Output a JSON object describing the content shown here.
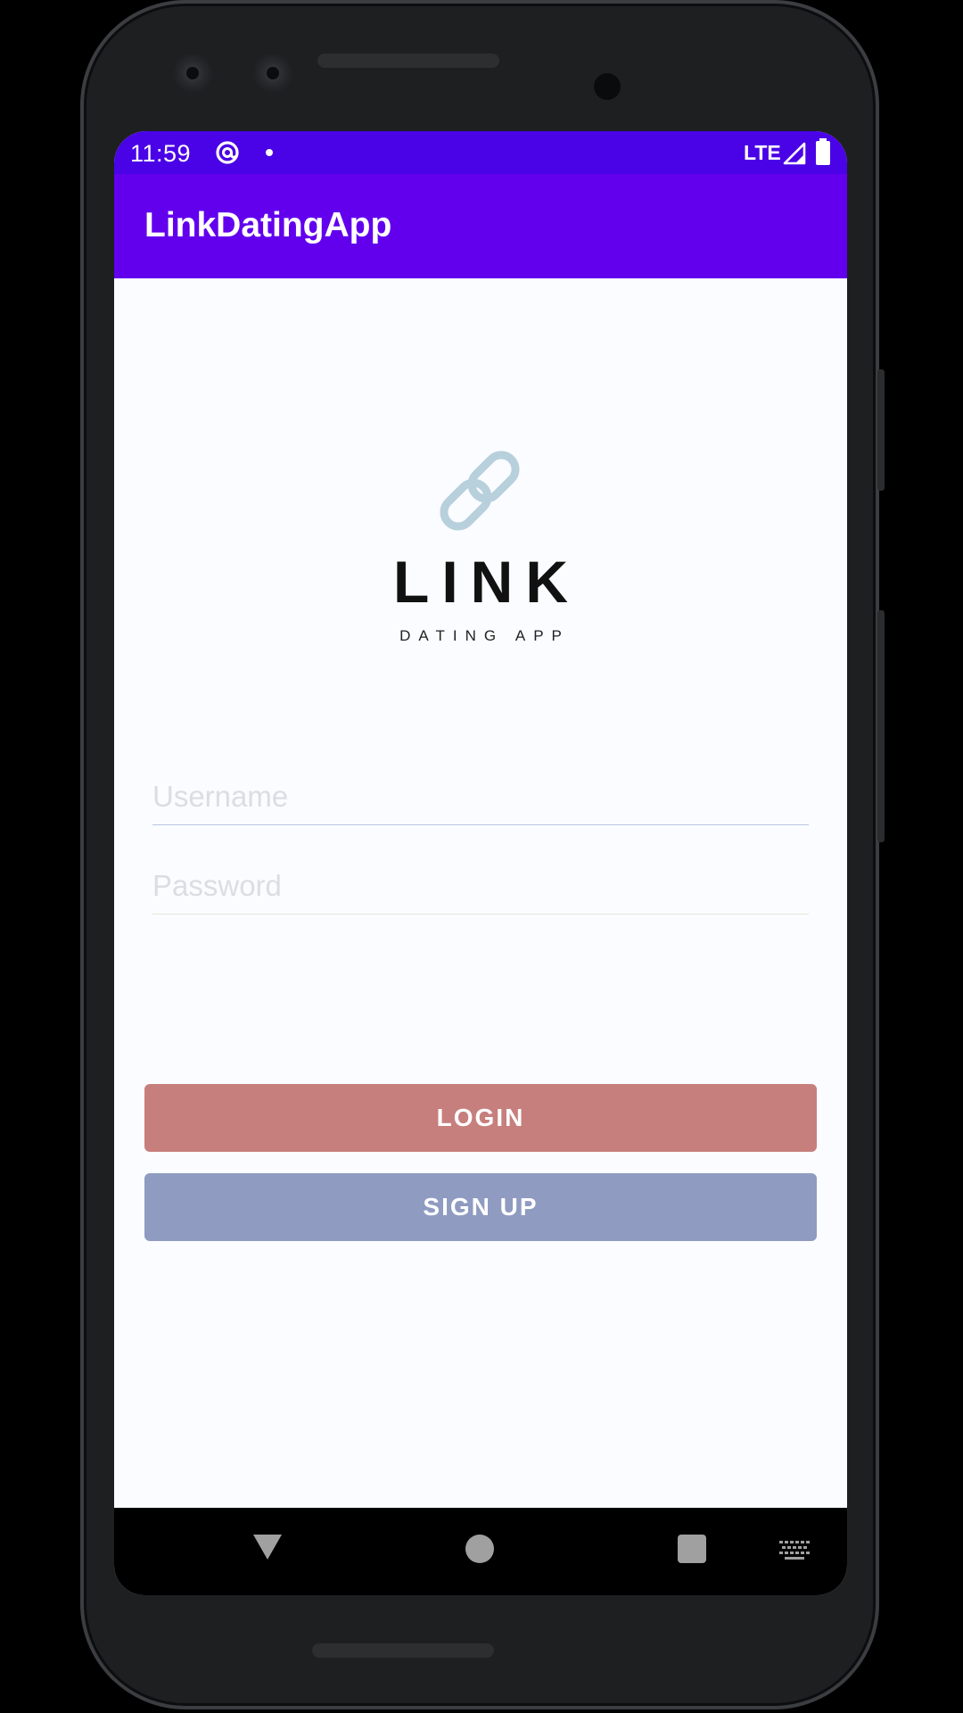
{
  "status_bar": {
    "time": "11:59",
    "network": "LTE",
    "background_color": "#4a02e6"
  },
  "app_bar": {
    "title": "LinkDatingApp",
    "background_color": "#6200ee"
  },
  "logo": {
    "icon": "chain-link-icon",
    "wordmark": "LINK",
    "tagline": "DATING APP",
    "icon_color": "#b7d0dc"
  },
  "form": {
    "username": {
      "placeholder": "Username",
      "value": ""
    },
    "password": {
      "placeholder": "Password",
      "value": ""
    }
  },
  "buttons": {
    "login_label": "LOGIN",
    "signup_label": "SIGN UP",
    "login_color": "#c77f7d",
    "signup_color": "#8f9bc1"
  },
  "navigation": {
    "back": "back-triangle-icon",
    "home": "home-circle-icon",
    "recents": "recents-square-icon",
    "keyboard": "keyboard-icon"
  }
}
